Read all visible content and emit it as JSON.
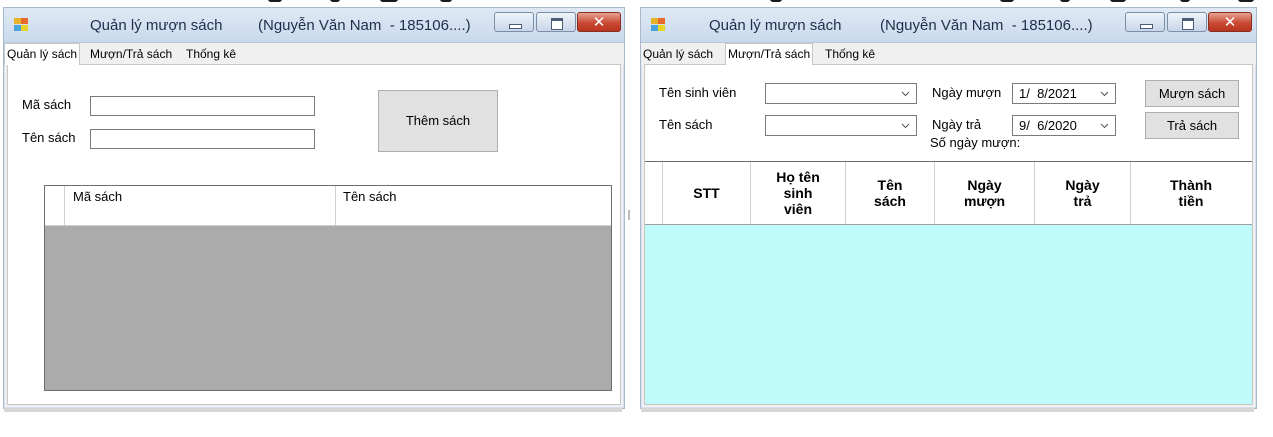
{
  "windows": [
    {
      "title": "Quản lý mượn sách",
      "subtitle": "(Nguyễn Văn Nam  - 185106....)",
      "tabs": [
        "Quản lý sách",
        "Mượn/Trả sách",
        "Thống kê"
      ],
      "active_tab": 0,
      "form": {
        "ma_sach_label": "Mã sách",
        "ten_sach_label": "Tên sách",
        "ma_sach_value": "",
        "ten_sach_value": "",
        "add_button": "Thêm sách"
      },
      "grid": {
        "columns": [
          "Mã sách",
          "Tên sách"
        ],
        "rows": [
          [
            "",
            ""
          ]
        ]
      }
    },
    {
      "title": "Quản lý mượn sách",
      "subtitle": "(Nguyễn Văn Nam  - 185106....)",
      "tabs": [
        "Quản lý sách",
        "Mượn/Trả sách",
        "Thống kê"
      ],
      "active_tab": 1,
      "form": {
        "student_label": "Tên sinh viên",
        "book_label": "Tên sách",
        "student_value": "",
        "book_value": "",
        "borrow_date_label": "Ngày mượn",
        "borrow_date_value": "1/  8/2021",
        "return_date_label": "Ngày trả",
        "return_date_value": "9/  6/2020",
        "days_label": "Số ngày mượn:",
        "borrow_button": "Mượn sách",
        "return_button": "Trả sách"
      },
      "grid": {
        "columns": [
          "STT",
          "Họ tên\nsinh\nviên",
          "Tên\nsách",
          "Ngày\nmượn",
          "Ngày\ntrả",
          "Thành\ntiền"
        ]
      }
    }
  ],
  "icons": [
    "app-icon",
    "minimize-icon",
    "maximize-icon",
    "close-icon",
    "dropdown-arrow-icon"
  ],
  "colors": {
    "titlebar": "#c9d9ec",
    "close_button": "#c94a35",
    "grid_empty_gray": "#ababab",
    "grid_empty_cyan": "#c0fbfb"
  }
}
